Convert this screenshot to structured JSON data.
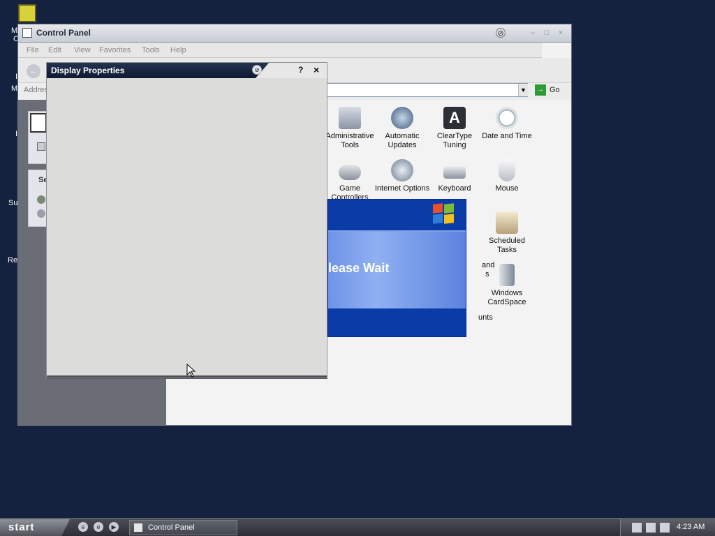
{
  "desktop": {
    "fragments": [
      "M",
      "C",
      "I",
      "M",
      "I",
      "Su",
      "Re"
    ]
  },
  "control_panel": {
    "title": "Control Panel",
    "menu": [
      "File",
      "Edit",
      "View",
      "Favorites",
      "Tools",
      "Help"
    ],
    "address_label": "Address",
    "go_label": "Go",
    "sidebar_fragment": "Se",
    "items": [
      {
        "label": "Administrative Tools",
        "icon": "admin-tools-icon"
      },
      {
        "label": "Automatic Updates",
        "icon": "updates-icon"
      },
      {
        "label": "ClearType Tuning",
        "icon": "cleartype-icon"
      },
      {
        "label": "Date and Time",
        "icon": "clock-icon"
      },
      {
        "label": "Game Controllers",
        "icon": "gamepad-icon"
      },
      {
        "label": "Internet Options",
        "icon": "globe-icon"
      },
      {
        "label": "Keyboard",
        "icon": "keyboard-icon"
      },
      {
        "label": "Mouse",
        "icon": "mouse-icon"
      },
      {
        "label": "Scheduled Tasks",
        "icon": "tasks-icon"
      },
      {
        "label": "Windows CardSpace",
        "icon": "cardspace-icon"
      }
    ],
    "partial_labels": [
      "and",
      "s",
      "unts"
    ]
  },
  "please_wait": {
    "text": "lease Wait"
  },
  "display_properties": {
    "title": "Display Properties",
    "help": "?",
    "close": "×"
  },
  "taskbar": {
    "start_label": "start",
    "task_label": "Control Panel",
    "clock": "4:23 AM"
  },
  "colors": {
    "desktop": "#14223f",
    "wait_blue": "#0a3ba6",
    "title_dark": "#1a2540"
  }
}
